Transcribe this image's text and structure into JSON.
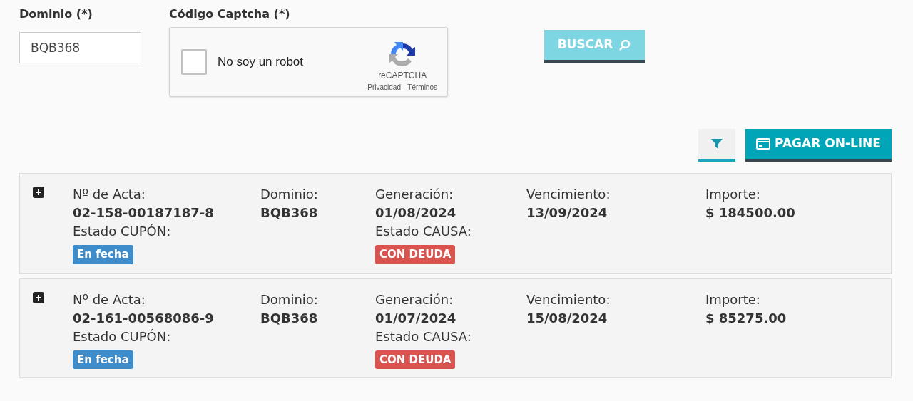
{
  "form": {
    "domain": {
      "label": "Dominio (*)",
      "value": "BQB368"
    },
    "captcha": {
      "label": "Código Captcha (*)",
      "checkbox_label": "No soy un robot",
      "checked": false,
      "brand": "reCAPTCHA",
      "privacy": "Privacidad",
      "separator": "-",
      "terms": "Términos"
    },
    "search_button": {
      "label": "BUSCAR",
      "disabled": true
    }
  },
  "toolbar": {
    "pay_button": {
      "label": "PAGAR ON-LINE"
    }
  },
  "records": [
    {
      "expanded": false,
      "fields": [
        {
          "label": "Nº de Acta:",
          "value": "02-158-00187187-8"
        },
        {
          "label": "Dominio:",
          "value": "BQB368"
        },
        {
          "label": "Generación:",
          "value": "01/08/2024"
        },
        {
          "label": "Vencimiento:",
          "value": "13/09/2024"
        },
        {
          "label": "Importe:",
          "value": "$ 184500.00"
        }
      ],
      "coupon_status": {
        "label": "Estado CUPÓN:",
        "badge": "En fecha",
        "color": "#3f8ccb"
      },
      "cause_status": {
        "label": "Estado CAUSA:",
        "badge": "CON DEUDA",
        "color": "#d9534f"
      }
    },
    {
      "expanded": false,
      "fields": [
        {
          "label": "Nº de Acta:",
          "value": "02-161-00568086-9"
        },
        {
          "label": "Dominio:",
          "value": "BQB368"
        },
        {
          "label": "Generación:",
          "value": "01/07/2024"
        },
        {
          "label": "Vencimiento:",
          "value": "15/08/2024"
        },
        {
          "label": "Importe:",
          "value": "$ 85275.00"
        }
      ],
      "coupon_status": {
        "label": "Estado CUPÓN:",
        "badge": "En fecha",
        "color": "#3f8ccb"
      },
      "cause_status": {
        "label": "Estado CAUSA:",
        "badge": "CON DEUDA",
        "color": "#d9534f"
      }
    }
  ]
}
